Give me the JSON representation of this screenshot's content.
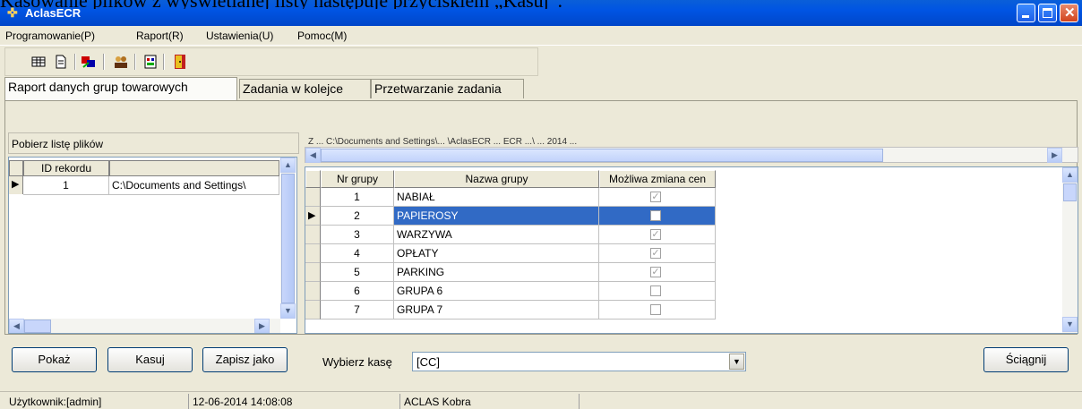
{
  "doc_text": "Kasowanie plików z wyświetlanej listy następuje przyciskiem „Kasuj”.",
  "window": {
    "title": "AclasECR"
  },
  "menu": [
    "Programowanie(P)",
    "Raport(R)",
    "Ustawienia(U)",
    "Pomoc(M)"
  ],
  "toolbar_icons": [
    "table-icon",
    "document-icon",
    "transfer-icon",
    "users-icon",
    "report-icon",
    "exit-door-icon"
  ],
  "tabs": [
    "Raport danych grup towarowych",
    "Zadania w kolejce",
    "Przetwarzanie zadania"
  ],
  "left_panel": {
    "header": "Pobierz listę plików",
    "columns": [
      "ID rekordu",
      ""
    ],
    "rows": [
      {
        "id": "1",
        "path": "C:\\Documents and Settings\\"
      }
    ]
  },
  "path_banner": "Z ... C:\\Documents and Settings\\... \\AclasECR ... ECR ...\\ ... 2014 ...",
  "grid": {
    "columns": [
      "Nr grupy",
      "Nazwa grupy",
      "Możliwa zmiana cen"
    ],
    "rows": [
      {
        "nr": "1",
        "name": "NABIAŁ",
        "checked": true
      },
      {
        "nr": "2",
        "name": "PAPIEROSY",
        "checked": false
      },
      {
        "nr": "3",
        "name": "WARZYWA",
        "checked": true
      },
      {
        "nr": "4",
        "name": "OPŁATY",
        "checked": true
      },
      {
        "nr": "5",
        "name": "PARKING",
        "checked": true
      },
      {
        "nr": "6",
        "name": "GRUPA 6",
        "checked": false
      },
      {
        "nr": "7",
        "name": "GRUPA 7",
        "checked": false
      }
    ],
    "selected_row": 2
  },
  "buttons": {
    "show": "Pokaż",
    "delete": "Kasuj",
    "save_as": "Zapisz jako",
    "download": "Ściągnij"
  },
  "cash_register": {
    "label": "Wybierz kasę",
    "value": "[CC]"
  },
  "status": {
    "user": "Użytkownik:[admin]",
    "datetime": "12-06-2014 14:08:08",
    "device": "ACLAS Kobra"
  },
  "colors": {
    "titlebar": "#0054e3",
    "selection": "#316ac5",
    "face": "#ece9d8"
  }
}
